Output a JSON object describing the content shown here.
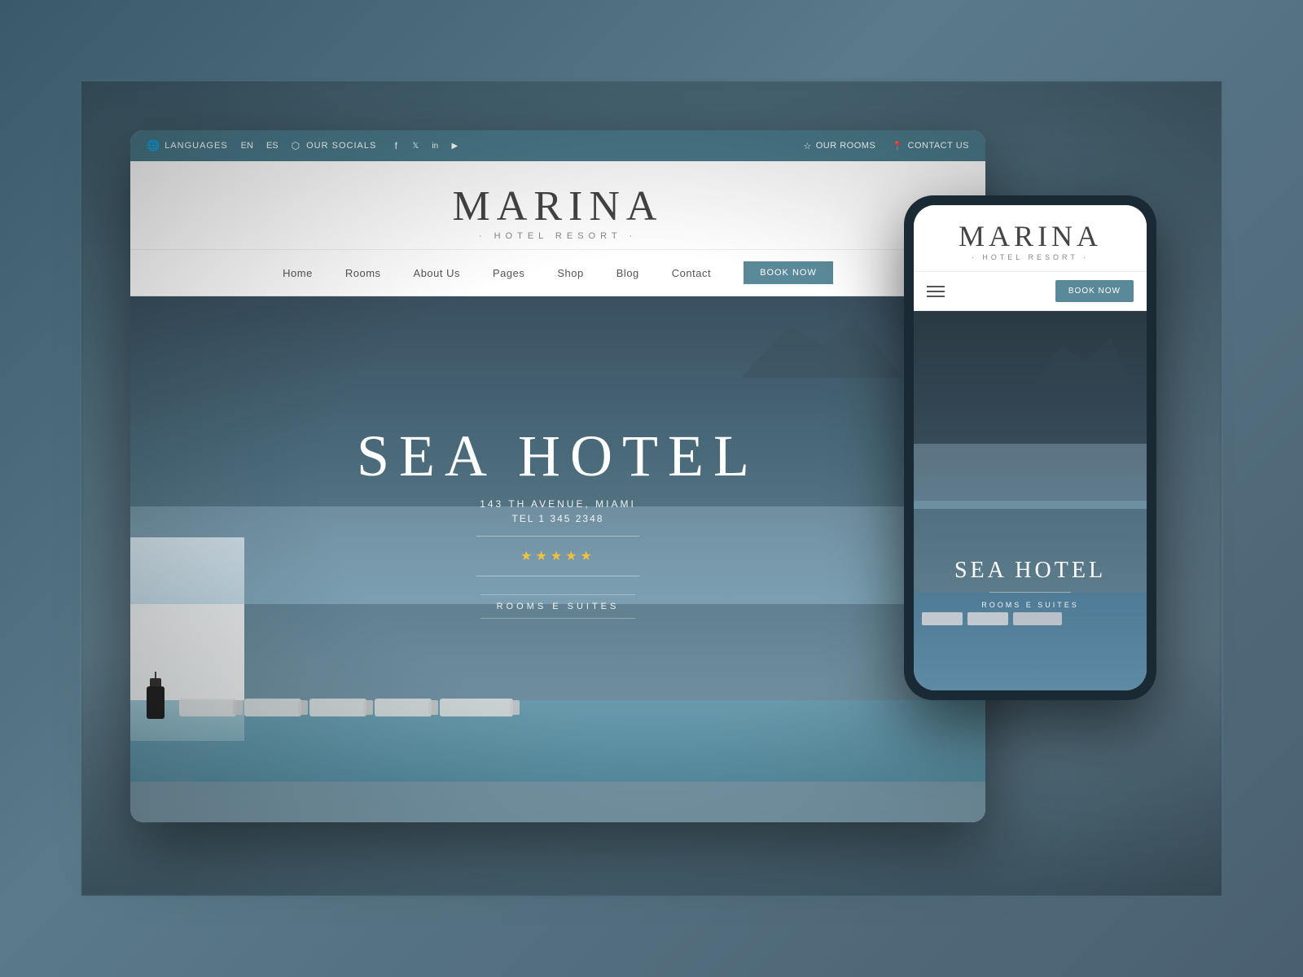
{
  "scene": {
    "background_color": "#4a6a7a"
  },
  "desktop": {
    "topbar": {
      "languages_label": "LANGUAGES",
      "lang_en": "EN",
      "lang_es": "ES",
      "socials_label": "OUR SOCIALS",
      "social_icons": [
        "f",
        "t",
        "in",
        "▶"
      ],
      "rooms_label": "OUR ROOMS",
      "contact_label": "CONTACT US"
    },
    "header": {
      "logo_main": "MARINA",
      "logo_sub": "· HOTEL RESORT ·"
    },
    "nav": {
      "items": [
        "Home",
        "Rooms",
        "About Us",
        "Pages",
        "Shop",
        "Blog",
        "Contact"
      ],
      "book_button": "BOOK NOW"
    },
    "hero": {
      "title": "SEA HOTEL",
      "address": "143 TH AVENUE, MIAMI",
      "tel": "TEL 1 345 2348",
      "stars": "★★★★★",
      "rooms_label": "ROOMS E SUITES"
    }
  },
  "mobile": {
    "header": {
      "logo_main": "MARINA",
      "logo_sub": "· HOTEL RESORT ·"
    },
    "nav": {
      "book_button": "BOOK NOW"
    },
    "hero": {
      "title": "SEA HOTEL",
      "rooms_label": "ROOMS E SUITES"
    }
  },
  "colors": {
    "teal": "#4a7a8a",
    "teal_button": "#5a8a9a",
    "text_dark": "#444444",
    "text_muted": "#888888",
    "white": "#ffffff",
    "star_gold": "#f0c040"
  }
}
